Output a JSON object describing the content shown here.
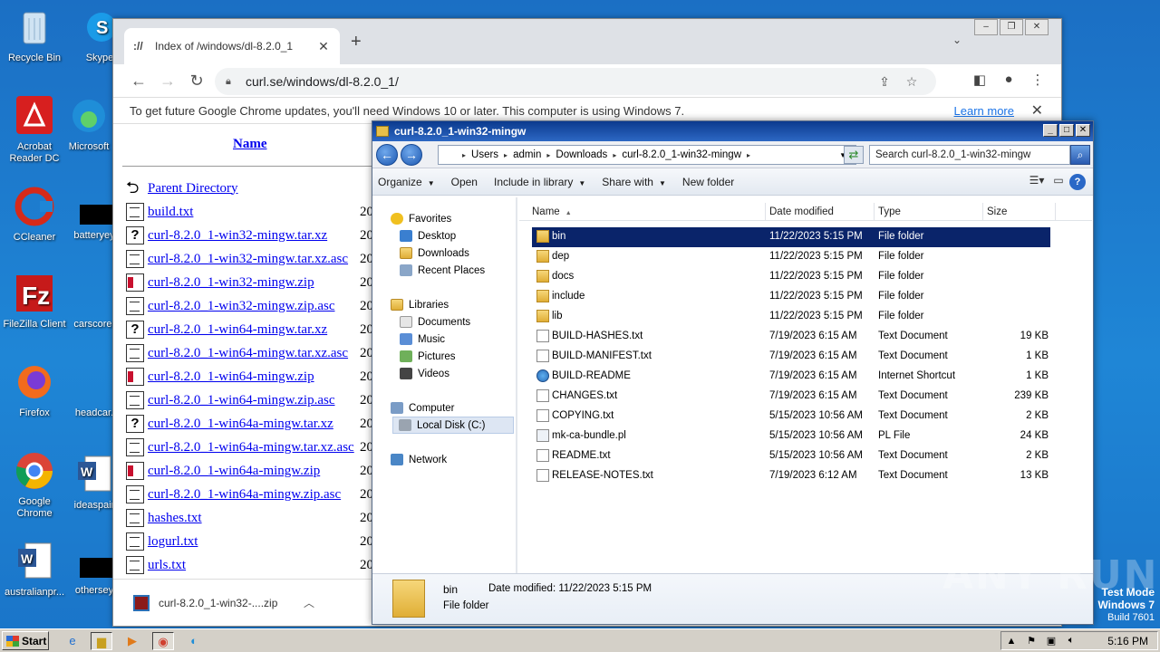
{
  "desktop": {
    "icons": [
      {
        "label": "Recycle Bin"
      },
      {
        "label": "Skype"
      },
      {
        "label": "Acrobat Reader DC"
      },
      {
        "label": "Microsoft"
      },
      {
        "label": "CCleaner"
      },
      {
        "label": "batteryey"
      },
      {
        "label": "FileZilla Client"
      },
      {
        "label": "carscore."
      },
      {
        "label": "Firefox"
      },
      {
        "label": "headcar."
      },
      {
        "label": "Google Chrome"
      },
      {
        "label": "ideaspair"
      },
      {
        "label": "australianpr..."
      },
      {
        "label": "othersey"
      }
    ]
  },
  "chrome": {
    "tab_title": "Index of /windows/dl-8.2.0_1",
    "url": "curl.se/windows/dl-8.2.0_1/",
    "infobar_text": "To get future Google Chrome updates, you'll need Windows 10 or later. This computer is using Windows 7.",
    "infobar_link": "Learn more",
    "listing": {
      "header": "Name",
      "parent": "Parent Directory",
      "year_prefix": "20",
      "files": [
        {
          "name": "build.txt",
          "icon": "text-file-icon"
        },
        {
          "name": "curl-8.2.0_1-win32-mingw.tar.xz",
          "icon": "unknown-file-icon"
        },
        {
          "name": "curl-8.2.0_1-win32-mingw.tar.xz.asc",
          "icon": "text-file-icon"
        },
        {
          "name": "curl-8.2.0_1-win32-mingw.zip",
          "icon": "zip-file-icon"
        },
        {
          "name": "curl-8.2.0_1-win32-mingw.zip.asc",
          "icon": "text-file-icon"
        },
        {
          "name": "curl-8.2.0_1-win64-mingw.tar.xz",
          "icon": "unknown-file-icon"
        },
        {
          "name": "curl-8.2.0_1-win64-mingw.tar.xz.asc",
          "icon": "text-file-icon"
        },
        {
          "name": "curl-8.2.0_1-win64-mingw.zip",
          "icon": "zip-file-icon"
        },
        {
          "name": "curl-8.2.0_1-win64-mingw.zip.asc",
          "icon": "text-file-icon"
        },
        {
          "name": "curl-8.2.0_1-win64a-mingw.tar.xz",
          "icon": "unknown-file-icon"
        },
        {
          "name": "curl-8.2.0_1-win64a-mingw.tar.xz.asc",
          "icon": "text-file-icon"
        },
        {
          "name": "curl-8.2.0_1-win64a-mingw.zip",
          "icon": "zip-file-icon"
        },
        {
          "name": "curl-8.2.0_1-win64a-mingw.zip.asc",
          "icon": "text-file-icon"
        },
        {
          "name": "hashes.txt",
          "icon": "text-file-icon"
        },
        {
          "name": "logurl.txt",
          "icon": "text-file-icon"
        },
        {
          "name": "urls.txt",
          "icon": "text-file-icon"
        }
      ]
    },
    "download": {
      "filename": "curl-8.2.0_1-win32-....zip"
    }
  },
  "explorer": {
    "title": "curl-8.2.0_1-win32-mingw",
    "breadcrumb": [
      "Users",
      "admin",
      "Downloads",
      "curl-8.2.0_1-win32-mingw"
    ],
    "search_placeholder": "Search curl-8.2.0_1-win32-mingw",
    "commands": {
      "organize": "Organize",
      "open": "Open",
      "include": "Include in library",
      "share": "Share with",
      "newfolder": "New folder"
    },
    "nav": {
      "favorites": "Favorites",
      "desktop": "Desktop",
      "downloads": "Downloads",
      "recent": "Recent Places",
      "libraries": "Libraries",
      "documents": "Documents",
      "music": "Music",
      "pictures": "Pictures",
      "videos": "Videos",
      "computer": "Computer",
      "localdisk": "Local Disk (C:)",
      "network": "Network"
    },
    "columns": {
      "name": "Name",
      "date": "Date modified",
      "type": "Type",
      "size": "Size"
    },
    "files": [
      {
        "name": "bin",
        "date": "11/22/2023 5:15 PM",
        "type": "File folder",
        "size": "",
        "icon": "folder-icon"
      },
      {
        "name": "dep",
        "date": "11/22/2023 5:15 PM",
        "type": "File folder",
        "size": "",
        "icon": "folder-icon"
      },
      {
        "name": "docs",
        "date": "11/22/2023 5:15 PM",
        "type": "File folder",
        "size": "",
        "icon": "folder-icon"
      },
      {
        "name": "include",
        "date": "11/22/2023 5:15 PM",
        "type": "File folder",
        "size": "",
        "icon": "folder-icon"
      },
      {
        "name": "lib",
        "date": "11/22/2023 5:15 PM",
        "type": "File folder",
        "size": "",
        "icon": "folder-icon"
      },
      {
        "name": "BUILD-HASHES.txt",
        "date": "7/19/2023 6:15 AM",
        "type": "Text Document",
        "size": "19 KB",
        "icon": "document-icon"
      },
      {
        "name": "BUILD-MANIFEST.txt",
        "date": "7/19/2023 6:15 AM",
        "type": "Text Document",
        "size": "1 KB",
        "icon": "document-icon"
      },
      {
        "name": "BUILD-README",
        "date": "7/19/2023 6:15 AM",
        "type": "Internet Shortcut",
        "size": "1 KB",
        "icon": "web-shortcut-icon"
      },
      {
        "name": "CHANGES.txt",
        "date": "7/19/2023 6:15 AM",
        "type": "Text Document",
        "size": "239 KB",
        "icon": "document-icon"
      },
      {
        "name": "COPYING.txt",
        "date": "5/15/2023 10:56 AM",
        "type": "Text Document",
        "size": "2 KB",
        "icon": "document-icon"
      },
      {
        "name": "mk-ca-bundle.pl",
        "date": "5/15/2023 10:56 AM",
        "type": "PL File",
        "size": "24 KB",
        "icon": "script-file-icon"
      },
      {
        "name": "README.txt",
        "date": "5/15/2023 10:56 AM",
        "type": "Text Document",
        "size": "2 KB",
        "icon": "document-icon"
      },
      {
        "name": "RELEASE-NOTES.txt",
        "date": "7/19/2023 6:12 AM",
        "type": "Text Document",
        "size": "13 KB",
        "icon": "document-icon"
      }
    ],
    "selected_index": 0,
    "details": {
      "name": "bin",
      "modified": "Date modified:  11/22/2023 5:15 PM",
      "type": "File folder"
    }
  },
  "watermark": "ANY RUN",
  "build": {
    "line1": "Test Mode",
    "line2": "Windows 7",
    "line3": "Build 7601"
  },
  "taskbar": {
    "start": "Start",
    "clock": "5:16 PM"
  }
}
